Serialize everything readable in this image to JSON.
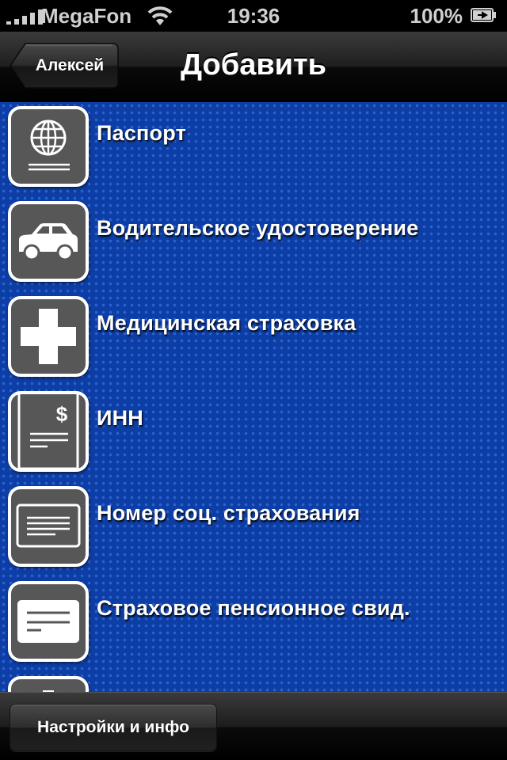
{
  "status_bar": {
    "carrier": "MegaFon",
    "time": "19:36",
    "battery": "100%",
    "icons": [
      "signal-bars-icon",
      "wifi-icon",
      "battery-charging-icon"
    ]
  },
  "nav": {
    "back_label": "Алексей",
    "title": "Добавить"
  },
  "list": {
    "items": [
      {
        "label": "Паспорт",
        "icon": "passport-globe-icon"
      },
      {
        "label": "Водительское удостоверение",
        "icon": "car-icon"
      },
      {
        "label": "Медицинская страховка",
        "icon": "medical-cross-icon"
      },
      {
        "label": "ИНН",
        "icon": "tax-document-icon"
      },
      {
        "label": "Номер соц. страхования",
        "icon": "social-card-icon"
      },
      {
        "label": "Страховое пенсионное свид.",
        "icon": "pension-card-icon"
      },
      {
        "label": "",
        "icon": "partial-document-icon"
      }
    ]
  },
  "toolbar": {
    "settings_label": "Настройки и инфо"
  },
  "colors": {
    "list_background": "#0d3ea6",
    "tile_background": "#575757",
    "tile_border": "#ffffff"
  }
}
